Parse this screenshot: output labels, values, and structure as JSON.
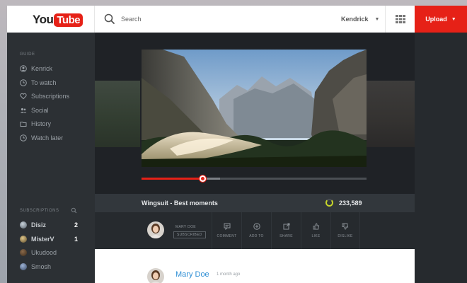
{
  "header": {
    "logo_you": "You",
    "logo_tube": "Tube",
    "search_placeholder": "Search",
    "user_name": "Kendrick",
    "upload_label": "Upload",
    "brand_color": "#e62117"
  },
  "sidebar": {
    "guide_heading": "GUIDE",
    "guide_items": [
      {
        "label": "Kenrick",
        "icon": "user-icon"
      },
      {
        "label": "To watch",
        "icon": "clock-icon"
      },
      {
        "label": "Subscriptions",
        "icon": "heart-icon"
      },
      {
        "label": "Social",
        "icon": "people-icon"
      },
      {
        "label": "History",
        "icon": "folder-icon"
      },
      {
        "label": "Watch later",
        "icon": "clock-icon"
      }
    ],
    "subscriptions_heading": "SUBSCRIPTIONS",
    "subscriptions": [
      {
        "name": "Disiz",
        "count": "2"
      },
      {
        "name": "MisterV",
        "count": "1"
      },
      {
        "name": "Ukudood",
        "count": ""
      },
      {
        "name": "Smosh",
        "count": ""
      }
    ]
  },
  "player": {
    "video_title": "Wingsuit - Best moments",
    "views": "233,589",
    "progress_played": 0.27,
    "progress_buffered": 0.35
  },
  "channel": {
    "name": "MARY DOE",
    "subscribed_label": "SUBSCRIBED"
  },
  "actions": [
    {
      "label": "COMMENT",
      "icon": "comment-icon"
    },
    {
      "label": "ADD TO",
      "icon": "plus-circle-icon"
    },
    {
      "label": "SHARE",
      "icon": "share-icon"
    },
    {
      "label": "LIKE",
      "icon": "thumbs-up-icon"
    },
    {
      "label": "DISLIKE",
      "icon": "thumbs-down-icon"
    }
  ],
  "comment": {
    "author": "Mary Doe",
    "time": "1 month ago"
  }
}
